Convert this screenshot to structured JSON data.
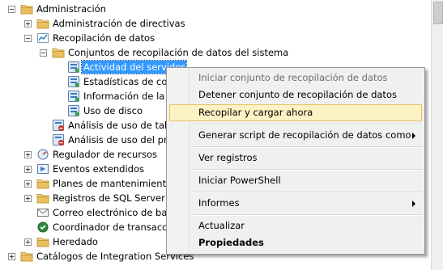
{
  "tree": {
    "administracion": "Administración",
    "directivas": "Administración de directivas",
    "recopilacion": "Recopilación de datos",
    "conjuntos": "Conjuntos de recopilación de datos del sistema",
    "actividad": "Actividad del servidor",
    "estadisticas": "Estadísticas de cons",
    "informacion": "Información de la ut",
    "uso_disco": "Uso de disco",
    "analisis_tabla": "Análisis de uso de tabla",
    "analisis_proc": "Análisis de uso del proc",
    "regulador": "Regulador de recursos",
    "eventos": "Eventos extendidos",
    "planes": "Planes de mantenimiento",
    "registros_sql": "Registros de SQL Server",
    "correo": "Correo electrónico de base",
    "coordinador": "Coordinador de transaccion",
    "heredado": "Heredado",
    "catalogos": "Catálogos de Integration Services"
  },
  "menu": {
    "iniciar_conjunto": "Iniciar conjunto de recopilación de datos",
    "detener_conjunto": "Detener conjunto de recopilación de datos",
    "recopilar": "Recopilar y cargar ahora",
    "generar_script": "Generar script de recopilación de datos como",
    "ver_registros": "Ver registros",
    "powershell": "Iniciar PowerShell",
    "informes": "Informes",
    "actualizar": "Actualizar",
    "propiedades": "Propiedades"
  },
  "colors": {
    "selection": "#3399ff",
    "menu_highlight": "#fcf3c4",
    "folder": "#e8c36a"
  }
}
